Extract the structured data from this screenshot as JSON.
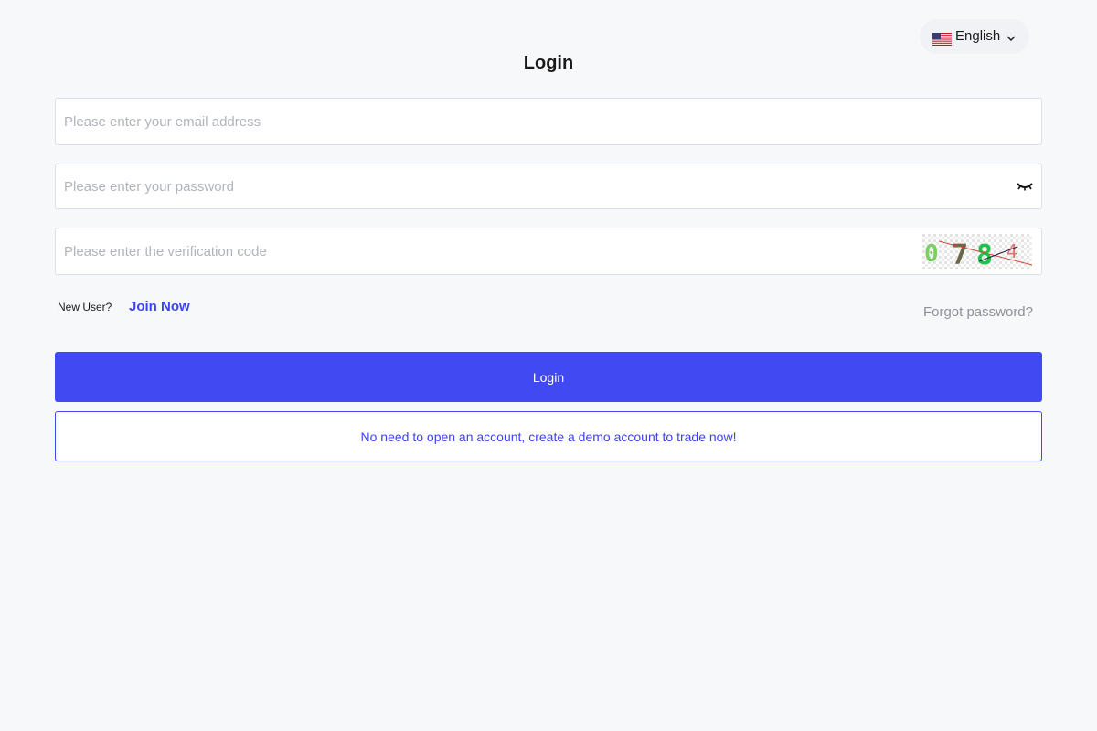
{
  "language": {
    "label": "English",
    "flag_icon": "us-flag-icon",
    "dropdown_icon": "chevron-down-icon"
  },
  "page_title": "Login",
  "form": {
    "email_placeholder": "Please enter your email address",
    "email_value": "",
    "password_placeholder": "Please enter your password",
    "password_value": "",
    "password_toggle_icon": "eye-closed-icon",
    "code_placeholder": "Please enter the verification code",
    "code_value": "",
    "captcha_text": [
      "0",
      "7",
      "8",
      "4"
    ],
    "captcha_colors": [
      "#7ccf62",
      "#6b6647",
      "#22c24a",
      "#e46f6f"
    ]
  },
  "links": {
    "new_user_label": "New User?",
    "join_now": "Join Now",
    "forgot_password": "Forgot password?"
  },
  "buttons": {
    "login": "Login",
    "demo": "No need to open an account, create a demo account to trade now!"
  },
  "colors": {
    "accent": "#4149f2",
    "background": "#f7f8fa"
  }
}
